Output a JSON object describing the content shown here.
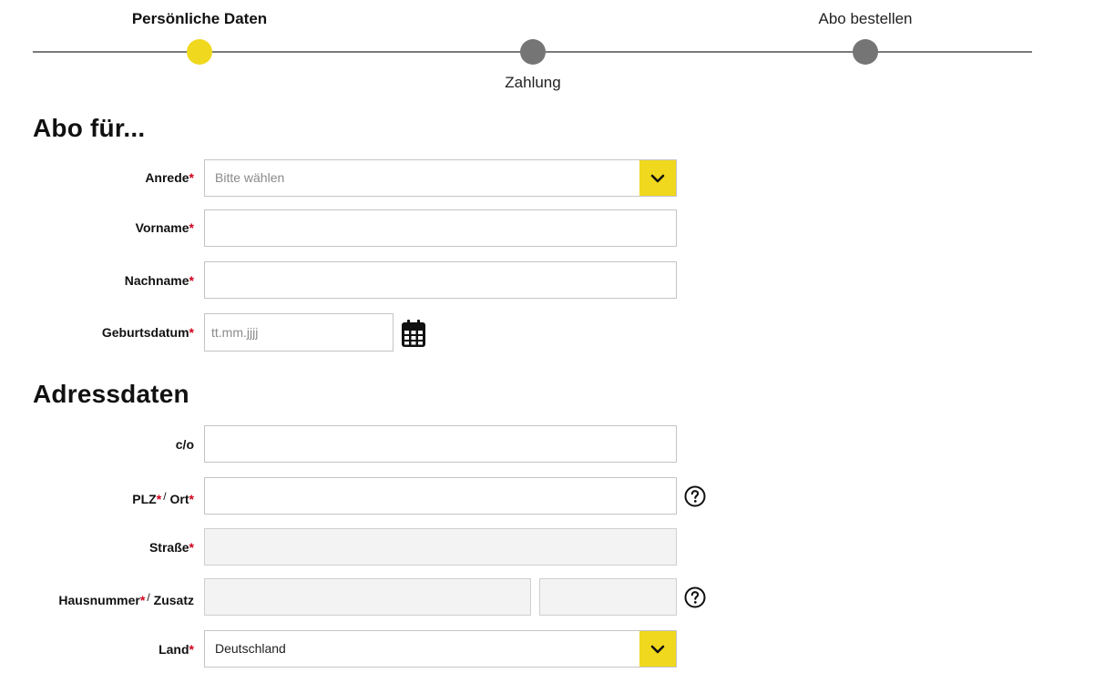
{
  "stepper": {
    "steps": [
      {
        "label": "Persönliche Daten",
        "state": "active"
      },
      {
        "label": "Zahlung",
        "state": "inactive"
      },
      {
        "label": "Abo bestellen",
        "state": "inactive"
      }
    ]
  },
  "colors": {
    "accent": "#f0d81e",
    "inactive_step": "#757575",
    "required": "#d0021b"
  },
  "section_abo": {
    "title": "Abo für...",
    "anrede": {
      "label": "Anrede",
      "required_mark": "*",
      "placeholder": "Bitte wählen",
      "icon": "chevron-down-icon"
    },
    "vorname": {
      "label": "Vorname",
      "required_mark": "*",
      "value": ""
    },
    "nachname": {
      "label": "Nachname",
      "required_mark": "*",
      "value": ""
    },
    "geburtsdatum": {
      "label": "Geburtsdatum",
      "required_mark": "*",
      "placeholder": "tt.mm.jjjj",
      "icon": "calendar-icon"
    }
  },
  "section_adresse": {
    "title": "Adressdaten",
    "co": {
      "label": "c/o",
      "value": ""
    },
    "plz_ort": {
      "label_plz": "PLZ",
      "separator": "/",
      "label_ort": "Ort",
      "required_mark": "*",
      "value": "",
      "icon": "help-icon"
    },
    "strasse": {
      "label": "Straße",
      "required_mark": "*",
      "value": ""
    },
    "hausnummer": {
      "label_nr": "Hausnummer",
      "separator": "/",
      "label_zusatz": "Zusatz",
      "required_mark": "*",
      "value": "",
      "zusatz_value": "",
      "icon": "help-icon"
    },
    "land": {
      "label": "Land",
      "required_mark": "*",
      "value": "Deutschland",
      "icon": "chevron-down-icon"
    }
  }
}
